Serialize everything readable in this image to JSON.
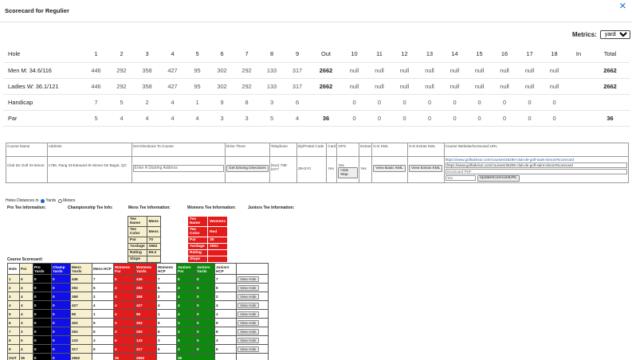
{
  "modal": {
    "title": "Scorecard for Regulier",
    "close_icon": "×"
  },
  "metrics": {
    "label": "Metrics:",
    "selected": "yards"
  },
  "scorecard": {
    "headers": [
      "Hole",
      "1",
      "2",
      "3",
      "4",
      "5",
      "6",
      "7",
      "8",
      "9",
      "Out",
      "10",
      "11",
      "12",
      "13",
      "14",
      "15",
      "16",
      "17",
      "18",
      "In",
      "Total"
    ],
    "rows": [
      {
        "label": "Men M: 34.6/116",
        "cells": [
          "446",
          "292",
          "358",
          "427",
          "95",
          "302",
          "292",
          "133",
          "317",
          "2662",
          "null",
          "null",
          "null",
          "null",
          "null",
          "null",
          "null",
          "null",
          "null",
          "",
          "2662"
        ]
      },
      {
        "label": "Ladies W: 36.1/121",
        "cells": [
          "446",
          "292",
          "358",
          "427",
          "95",
          "302",
          "292",
          "133",
          "317",
          "2662",
          "null",
          "null",
          "null",
          "null",
          "null",
          "null",
          "null",
          "null",
          "null",
          "",
          "2662"
        ]
      },
      {
        "label": "Handicap",
        "cells": [
          "7",
          "5",
          "2",
          "4",
          "1",
          "9",
          "8",
          "3",
          "6",
          "",
          "0",
          "0",
          "0",
          "0",
          "0",
          "0",
          "0",
          "0",
          "0",
          "",
          ""
        ]
      },
      {
        "label": "Par",
        "cells": [
          "5",
          "4",
          "4",
          "4",
          "4",
          "3",
          "3",
          "5",
          "4",
          "36",
          "0",
          "0",
          "0",
          "0",
          "0",
          "0",
          "0",
          "0",
          "0",
          "",
          "36"
        ]
      }
    ]
  },
  "course_info": {
    "headers": {
      "course_name": "Course Name",
      "address": "Address",
      "directions": "Get Directions To Course",
      "drive_there": "Drive There",
      "telephone": "Telephone",
      "zip": "Zip/Postal Code",
      "card": "Card",
      "gps": "GPS",
      "extras": "Extras",
      "ge_kml": "G-E KML",
      "ge_extras_kml": "G-E Extras KML",
      "website": "Course Website/Scorecard URL"
    },
    "values": {
      "course_name": "Club De Golf St-Simon",
      "address": "1786, Rang St-Edouard St-Simon De Bagot, QC",
      "directions_placeholder": "Enter A Starting Address",
      "driving_button": "Get Driving Directions",
      "telephone": "(514) 798-2477",
      "zip": "J0H1Y0",
      "card": "Yes",
      "gps": "Yes",
      "hole_map_button": "Hole Map",
      "extras": "Yes",
      "kml_button": "View Basic KML",
      "extras_kml_button": "View Extras KML",
      "website_link": "https://www.golfadvisor.com/courses/35290-club-de-golf-saint-simon#scorecard",
      "website_input": "https://www.golfadvisor.com/courses/35290-club-de-golf-saint-simon#scorecard",
      "scorecard_pdf_placeholder": "Scorecard PDF",
      "yes_input": "Yes",
      "update_button": "UpdateScorecardURL"
    }
  },
  "hole_distances": {
    "label": "Holes Distances in",
    "opt_yards": "Yards",
    "opt_meters": "Meters"
  },
  "tee_info": {
    "pro": "Pro Tee Information:",
    "championship": "Championship Tee Info:",
    "mens": "Mens Tee Information:",
    "womens": "Womens Tee Information:",
    "juniors": "Juniors Tee Information:"
  },
  "mens_tee": [
    [
      "Tee Name",
      "Mens"
    ],
    [
      "Tee Color",
      "Mens"
    ],
    [
      "Par",
      "70"
    ],
    [
      "Yardage",
      "2662"
    ],
    [
      "Rating",
      "69.4"
    ],
    [
      "Slope",
      ""
    ]
  ],
  "womens_tee": [
    [
      "Tee Name",
      "Womens"
    ],
    [
      "Tee Color",
      "Red"
    ],
    [
      "Par",
      "36"
    ],
    [
      "Yardage",
      "2662"
    ],
    [
      "Rating",
      ""
    ],
    [
      "Slope",
      ""
    ]
  ],
  "course_scorecard": {
    "label": "Course Scorecard:",
    "headers": [
      "Hole",
      "Par",
      "Pro Yards",
      "Champ Yards",
      "Mens Yards",
      "Mens HCP",
      "Womens Par",
      "Womens Yards",
      "Womens HCP",
      "Juniors Par",
      "Juniors Yards",
      "Juniors HCP",
      ""
    ],
    "view_label": "View Hole",
    "rows": [
      [
        "1",
        "5",
        "0",
        "0",
        "446",
        "7",
        "5",
        "446",
        "7",
        "5",
        "0",
        "7"
      ],
      [
        "2",
        "4",
        "0",
        "0",
        "292",
        "5",
        "4",
        "292",
        "5",
        "4",
        "0",
        "5"
      ],
      [
        "3",
        "4",
        "0",
        "0",
        "358",
        "2",
        "4",
        "358",
        "2",
        "4",
        "0",
        "2"
      ],
      [
        "4",
        "4",
        "0",
        "0",
        "427",
        "4",
        "4",
        "427",
        "4",
        "4",
        "0",
        "4"
      ],
      [
        "5",
        "4",
        "0",
        "0",
        "95",
        "1",
        "4",
        "95",
        "1",
        "4",
        "0",
        "1"
      ],
      [
        "6",
        "3",
        "0",
        "0",
        "302",
        "9",
        "3",
        "302",
        "9",
        "3",
        "0",
        "9"
      ],
      [
        "7",
        "3",
        "0",
        "0",
        "292",
        "8",
        "3",
        "292",
        "8",
        "3",
        "0",
        "8"
      ],
      [
        "8",
        "5",
        "0",
        "0",
        "133",
        "3",
        "5",
        "133",
        "3",
        "5",
        "0",
        "3"
      ],
      [
        "9",
        "4",
        "0",
        "0",
        "317",
        "6",
        "4",
        "317",
        "6",
        "4",
        "0",
        "6"
      ]
    ],
    "out_row": [
      "OUT",
      "36",
      "0",
      "0",
      "2662",
      "",
      "36",
      "2662",
      "",
      "36",
      "",
      ""
    ]
  }
}
